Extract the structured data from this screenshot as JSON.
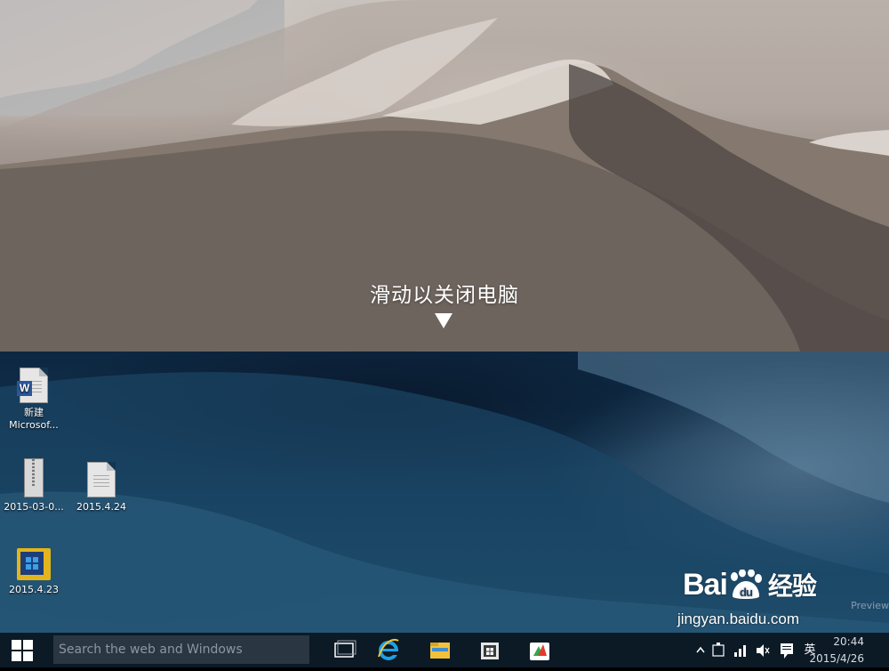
{
  "shutdown": {
    "prompt": "滑动以关闭电脑",
    "arrow_icon": "arrow-down-icon"
  },
  "desktop_icons": [
    {
      "label_line1": "新建",
      "label_line2": "Microsof...",
      "icon": "word-document-icon"
    },
    {
      "label": "2015-03-0...",
      "icon": "zip-archive-icon"
    },
    {
      "label": "2015.4.24",
      "icon": "file-icon"
    },
    {
      "label": "2015.4.23",
      "icon": "windows-tile-icon"
    }
  ],
  "watermark_partial": "Preview",
  "taskbar": {
    "search_placeholder": "Search the web and Windows",
    "apps": [
      "task-view-icon",
      "internet-explorer-icon",
      "file-explorer-icon",
      "store-icon",
      "app-icon"
    ],
    "ime_label": "英",
    "time": "20:44",
    "date": "2015/4/26"
  },
  "baidu": {
    "logo_left": "Bai",
    "logo_right": "du",
    "logo_cn": "经验",
    "url": "jingyan.baidu.com"
  },
  "colors": {
    "taskbar": "#0c1a26",
    "search_box": "#2a3742",
    "word_blue": "#2b579a",
    "ie_blue": "#1ea1e6",
    "explorer_yellow": "#f3c13a"
  }
}
